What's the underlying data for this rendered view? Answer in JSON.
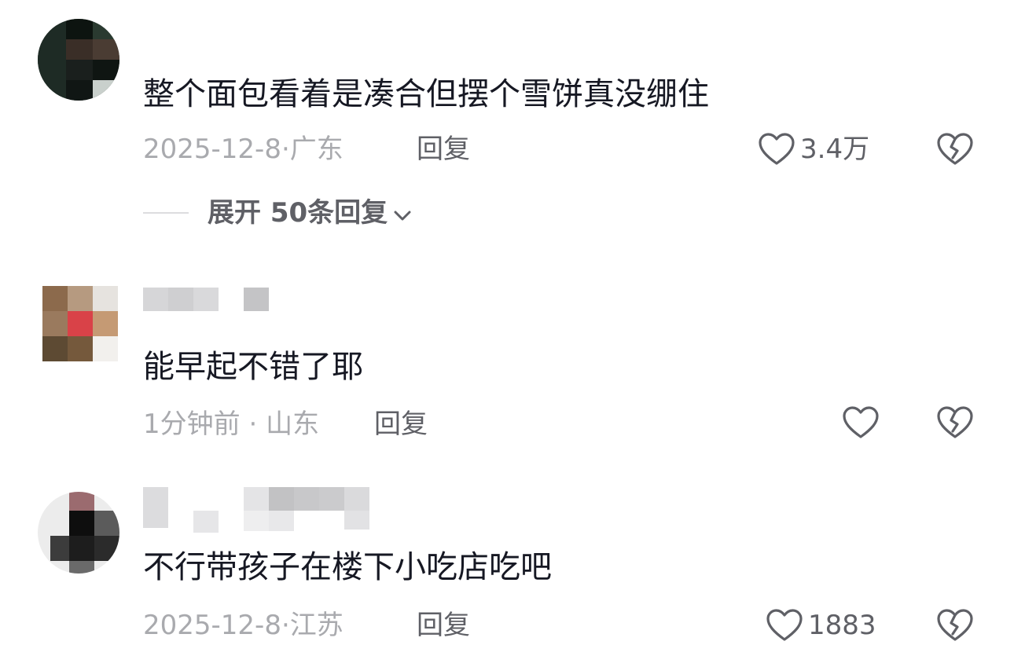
{
  "comments": [
    {
      "text": "整个面包看着是凑合但摆个雪饼真没绷住",
      "date": "2025-12-8",
      "location": "广东",
      "reply_label": "回复",
      "likes": "3.4万",
      "expand_label": "展开 50条回复"
    },
    {
      "text": "能早起不错了耶",
      "date": "1分钟前",
      "location": "山东",
      "reply_label": "回复",
      "likes": ""
    },
    {
      "text": "不行带孩子在楼下小吃店吃吧",
      "date": "2025-12-8",
      "location": "江苏",
      "reply_label": "回复",
      "likes": "1883"
    }
  ],
  "separator": "·",
  "icons": {
    "like": "heart-outline-icon",
    "dislike": "broken-heart-outline-icon",
    "expand": "chevron-down-icon"
  },
  "colors": {
    "text_primary": "#161823",
    "text_meta": "#a9aaae",
    "text_action": "#5f6066"
  }
}
